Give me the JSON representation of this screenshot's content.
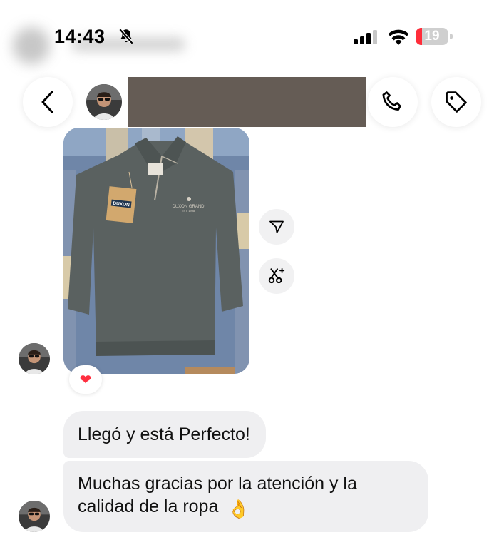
{
  "status_bar": {
    "time": "14:43",
    "battery_level": "19",
    "battery_fraction": 0.19,
    "icons": [
      "bell-slash-icon",
      "cellular-signal-icon",
      "wifi-icon",
      "battery-icon"
    ]
  },
  "header": {
    "icons": [
      "chevron-left-icon",
      "phone-icon",
      "tag-icon"
    ]
  },
  "conversation": {
    "photo": {
      "description_icons": [
        "share-icon",
        "remix-icon"
      ],
      "tag_brand": "DUXON",
      "reaction": "❤"
    },
    "messages": [
      {
        "text": "Llegó y está Perfecto!"
      },
      {
        "text": "Muchas gracias por la atención y la calidad de la ropa",
        "emoji": "👌"
      }
    ]
  },
  "colors": {
    "bubble": "#efeff1",
    "redaction": "#655c55",
    "battery_low": "#ff2d3a",
    "heart": "#ff2f40"
  }
}
